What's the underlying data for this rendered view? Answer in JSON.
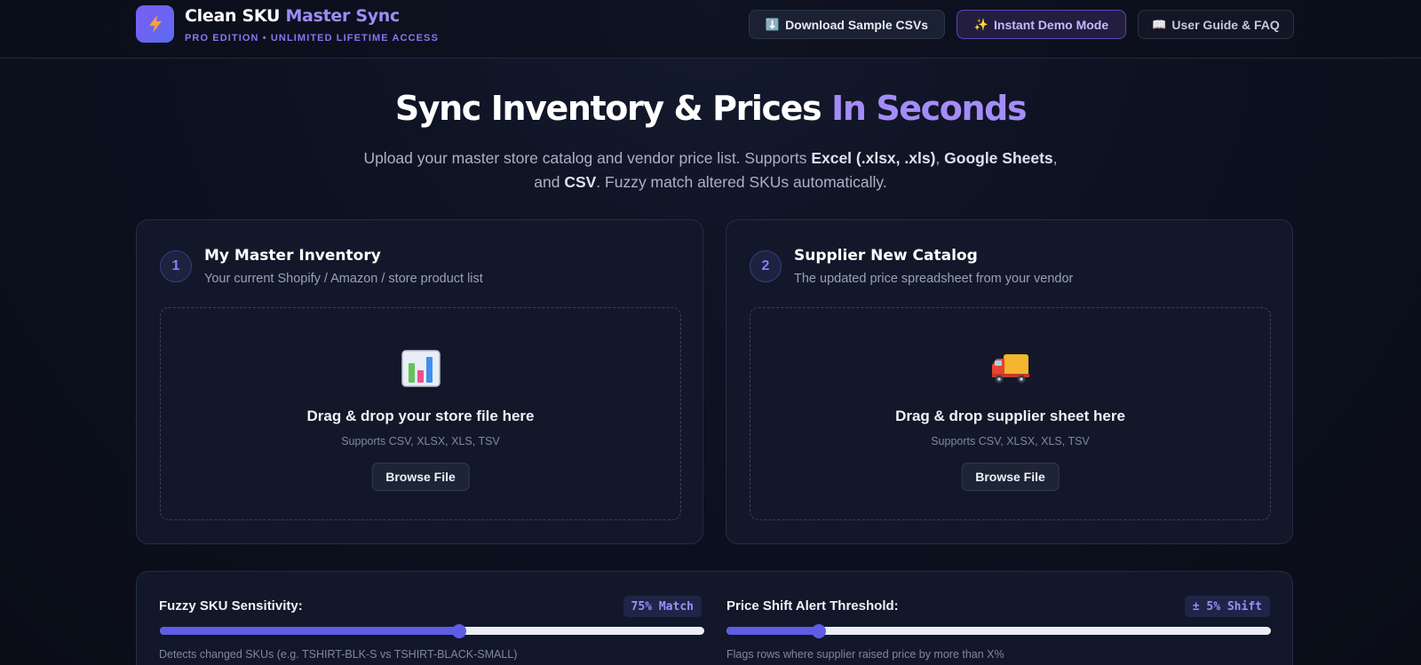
{
  "header": {
    "brand_main": "Clean SKU",
    "brand_accent": "Master Sync",
    "brand_sub": "PRO EDITION • UNLIMITED LIFETIME ACCESS",
    "buttons": [
      {
        "icon": "⬇️",
        "label": "Download Sample CSVs"
      },
      {
        "icon": "✨",
        "label": "Instant Demo Mode"
      },
      {
        "icon": "📖",
        "label": "User Guide & FAQ"
      }
    ]
  },
  "hero": {
    "title_main": "Sync Inventory & Prices",
    "title_accent": "In Seconds",
    "desc_1": "Upload your master store catalog and vendor price list. Supports ",
    "desc_b1": "Excel (.xlsx, .xls)",
    "desc_2": ", ",
    "desc_b2": "Google Sheets",
    "desc_3": ", and ",
    "desc_b3": "CSV",
    "desc_4": ". Fuzzy match altered SKUs automatically."
  },
  "cards": [
    {
      "step": "1",
      "title": "My Master Inventory",
      "subtitle": "Your current Shopify / Amazon / store product list",
      "icon": "bar-chart-icon",
      "drop_title": "Drag & drop your store file here",
      "drop_sub": "Supports CSV, XLSX, XLS, TSV",
      "browse": "Browse File"
    },
    {
      "step": "2",
      "title": "Supplier New Catalog",
      "subtitle": "The updated price spreadsheet from your vendor",
      "icon": "delivery-truck-icon",
      "drop_title": "Drag & drop supplier sheet here",
      "drop_sub": "Supports CSV, XLSX, XLS, TSV",
      "browse": "Browse File"
    }
  ],
  "settings": {
    "fuzzy": {
      "label": "Fuzzy SKU Sensitivity:",
      "badge": "75% Match",
      "value_fraction": 0.55,
      "help": "Detects changed SKUs (e.g. TSHIRT-BLK-S vs TSHIRT-BLACK-SMALL)"
    },
    "price": {
      "label": "Price Shift Alert Threshold:",
      "badge": "± 5% Shift",
      "value_fraction": 0.17,
      "help": "Flags rows where supplier raised price by more than X%"
    }
  },
  "colors": {
    "accent": "#8b74f4",
    "slider_fill": "#5f5ce6",
    "background": "#0d1120"
  }
}
